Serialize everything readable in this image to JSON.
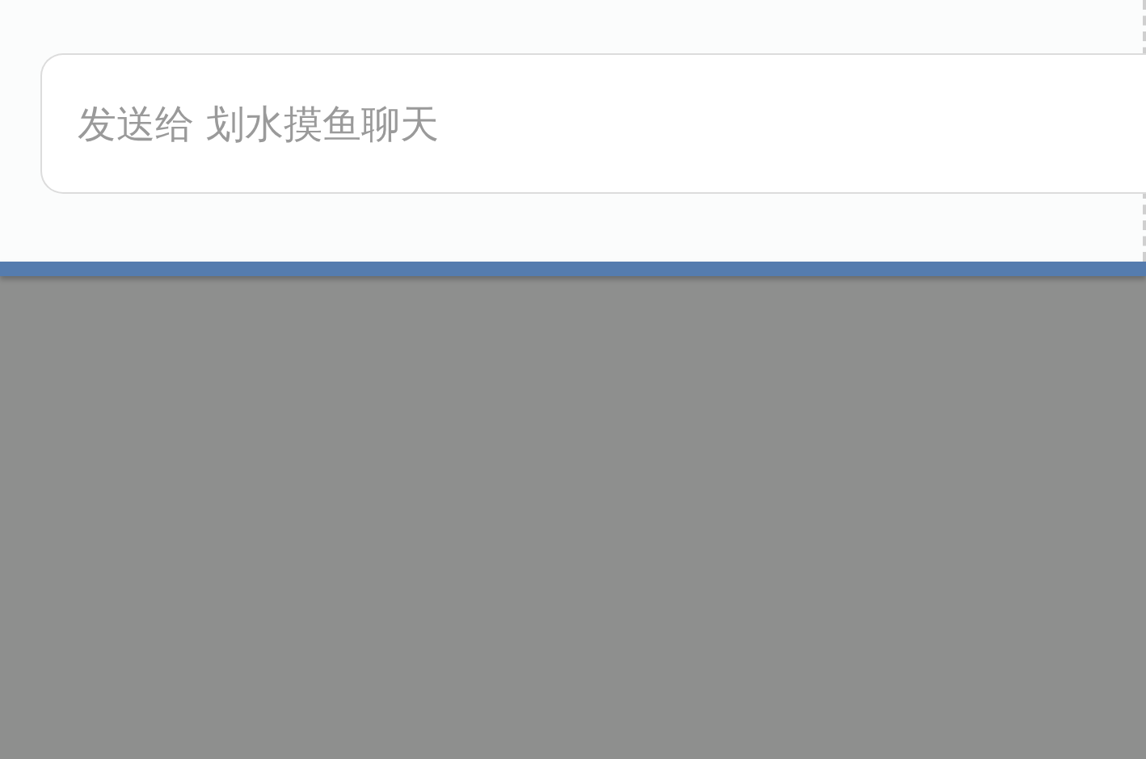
{
  "message_input": {
    "placeholder": "发送给 划水摸鱼聊天"
  }
}
